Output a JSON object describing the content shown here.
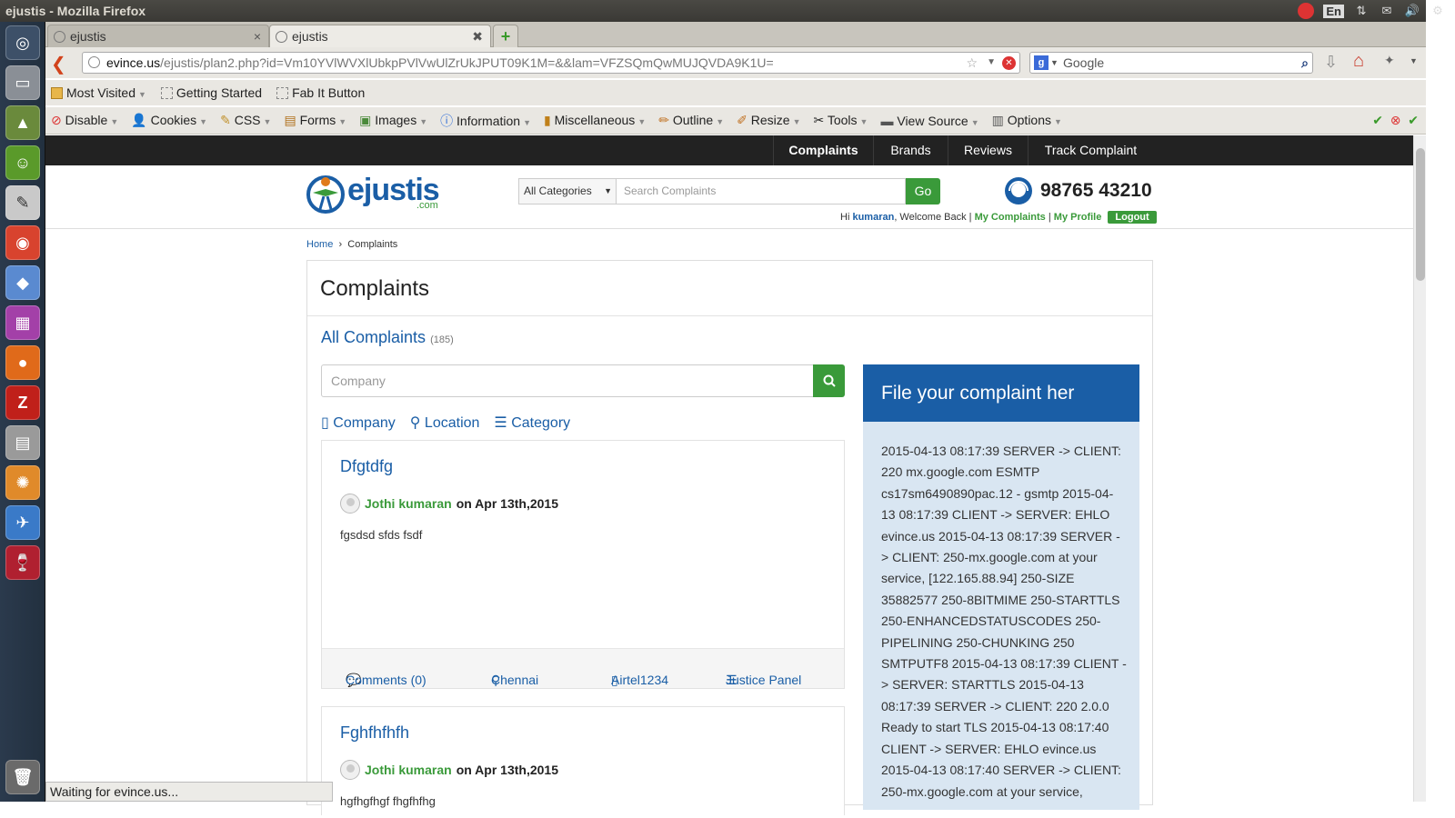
{
  "window": {
    "title": "ejustis - Mozilla Firefox"
  },
  "tray": {
    "lang": "En"
  },
  "tabs": [
    {
      "label": "ejustis"
    },
    {
      "label": "ejustis"
    }
  ],
  "address": {
    "host": "evince.us",
    "path": "/ejustis/plan2.php?id=Vm10YVlWVXlUbkpPVlVwUlZrUkJPUT09K1M=&&lam=VFZSQmQwMUJQVDA9K1U="
  },
  "web_search": {
    "placeholder": "Google"
  },
  "bookmarks": [
    "Most Visited",
    "Getting Started",
    "Fab It Button"
  ],
  "devbar": [
    "Disable",
    "Cookies",
    "CSS",
    "Forms",
    "Images",
    "Information",
    "Miscellaneous",
    "Outline",
    "Resize",
    "Tools",
    "View Source",
    "Options"
  ],
  "site_nav": [
    "Complaints",
    "Brands",
    "Reviews",
    "Track Complaint"
  ],
  "header": {
    "logo": "ejustis",
    "logo_sub": ".com",
    "category": "All Categories",
    "search_placeholder": "Search Complaints",
    "go": "Go",
    "phone": "98765 43210",
    "hi": "Hi",
    "user": "kumaran",
    "welcome": ", Welcome Back |",
    "my_complaints": "My Complaints",
    "sep": "|",
    "my_profile": "My Profile",
    "logout": "Logout"
  },
  "breadcrumb": {
    "home": "Home",
    "sep": "›",
    "current": "Complaints"
  },
  "main": {
    "title": "Complaints",
    "all_label": "All Complaints",
    "all_count": "(185)",
    "company_placeholder": "Company",
    "filters": [
      "Company",
      "Location",
      "Category"
    ]
  },
  "complaints": [
    {
      "title": "Dfgtdfg",
      "author": "Jothi kumaran",
      "date": "on Apr 13th,2015",
      "body": "fgsdsd sfds fsdf",
      "comments": "Comments (0)",
      "location": "Chennai",
      "company": "Airtel1234",
      "category": "Justice Panel"
    },
    {
      "title": "Fghfhfhfh",
      "author": "Jothi kumaran",
      "date": "on Apr 13th,2015",
      "body": "hgfhgfhgf fhgfhfhg"
    }
  ],
  "sidebar": {
    "heading": "File your complaint her",
    "log": "2015-04-13 08:17:39 SERVER -> CLIENT: 220 mx.google.com ESMTP cs17sm6490890pac.12 - gsmtp 2015-04-13 08:17:39 CLIENT -> SERVER: EHLO evince.us 2015-04-13 08:17:39 SERVER -> CLIENT: 250-mx.google.com at your service, [122.165.88.94] 250-SIZE 35882577 250-8BITMIME 250-STARTTLS 250-ENHANCEDSTATUSCODES 250-PIPELINING 250-CHUNKING 250 SMTPUTF8 2015-04-13 08:17:39 CLIENT -> SERVER: STARTTLS 2015-04-13 08:17:39 SERVER -> CLIENT: 220 2.0.0 Ready to start TLS 2015-04-13 08:17:40 CLIENT -> SERVER: EHLO evince.us 2015-04-13 08:17:40 SERVER -> CLIENT: 250-mx.google.com at your service,"
  },
  "status": "Waiting for evince.us..."
}
